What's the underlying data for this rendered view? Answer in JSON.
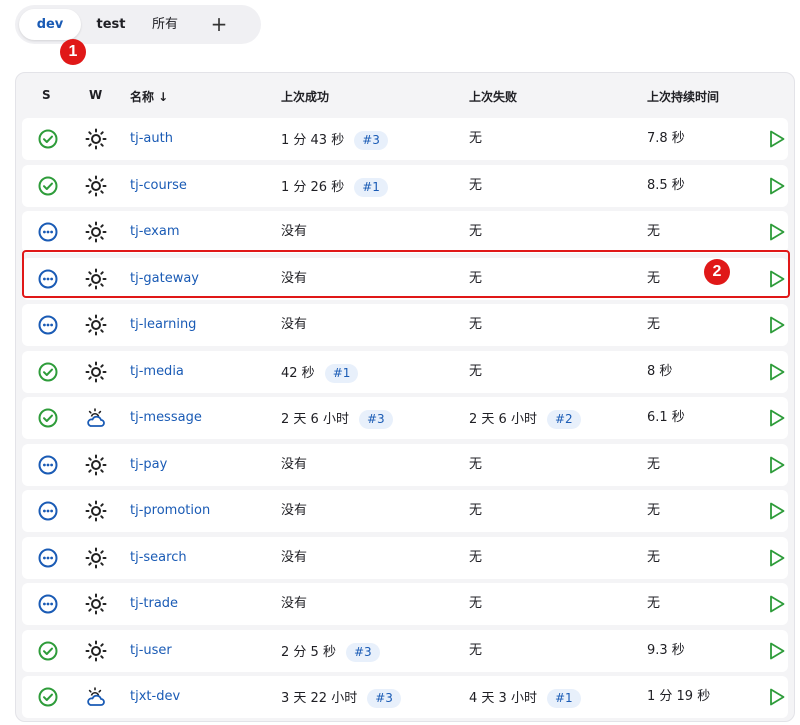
{
  "tabs": [
    {
      "label": "dev",
      "active": true
    },
    {
      "label": "test",
      "active": false
    },
    {
      "label": "所有",
      "active": false
    }
  ],
  "add_tab_label": "+",
  "annotations": [
    "1",
    "2"
  ],
  "columns": {
    "s": "S",
    "w": "W",
    "name": "名称 ↓",
    "last_success": "上次成功",
    "last_failure": "上次失败",
    "last_duration": "上次持续时间"
  },
  "colors": {
    "success": "#2e9c3a",
    "notbuilt": "#1a5bb5",
    "link": "#1a5bb5",
    "highlight": "#e01818",
    "run": "#2e9c3a"
  },
  "jobs": [
    {
      "status": "success-icon",
      "weather": "sunny-icon",
      "name": "tj-auth",
      "last_success": "1 分 43 秒",
      "success_build": "#3",
      "last_failure": "无",
      "failure_build": "",
      "last_duration": "7.8 秒"
    },
    {
      "status": "success-icon",
      "weather": "sunny-icon",
      "name": "tj-course",
      "last_success": "1 分 26 秒",
      "success_build": "#1",
      "last_failure": "无",
      "failure_build": "",
      "last_duration": "8.5 秒"
    },
    {
      "status": "notbuilt-icon",
      "weather": "sunny-icon",
      "name": "tj-exam",
      "last_success": "没有",
      "success_build": "",
      "last_failure": "无",
      "failure_build": "",
      "last_duration": "无"
    },
    {
      "status": "notbuilt-icon",
      "weather": "sunny-icon",
      "name": "tj-gateway",
      "last_success": "没有",
      "success_build": "",
      "last_failure": "无",
      "failure_build": "",
      "last_duration": "无"
    },
    {
      "status": "notbuilt-icon",
      "weather": "sunny-icon",
      "name": "tj-learning",
      "last_success": "没有",
      "success_build": "",
      "last_failure": "无",
      "failure_build": "",
      "last_duration": "无"
    },
    {
      "status": "success-icon",
      "weather": "sunny-icon",
      "name": "tj-media",
      "last_success": "42 秒",
      "success_build": "#1",
      "last_failure": "无",
      "failure_build": "",
      "last_duration": "8 秒"
    },
    {
      "status": "success-icon",
      "weather": "cloudy-icon",
      "name": "tj-message",
      "last_success": "2 天 6 小时",
      "success_build": "#3",
      "last_failure": "2 天 6 小时",
      "failure_build": "#2",
      "last_duration": "6.1 秒"
    },
    {
      "status": "notbuilt-icon",
      "weather": "sunny-icon",
      "name": "tj-pay",
      "last_success": "没有",
      "success_build": "",
      "last_failure": "无",
      "failure_build": "",
      "last_duration": "无"
    },
    {
      "status": "notbuilt-icon",
      "weather": "sunny-icon",
      "name": "tj-promotion",
      "last_success": "没有",
      "success_build": "",
      "last_failure": "无",
      "failure_build": "",
      "last_duration": "无"
    },
    {
      "status": "notbuilt-icon",
      "weather": "sunny-icon",
      "name": "tj-search",
      "last_success": "没有",
      "success_build": "",
      "last_failure": "无",
      "failure_build": "",
      "last_duration": "无"
    },
    {
      "status": "notbuilt-icon",
      "weather": "sunny-icon",
      "name": "tj-trade",
      "last_success": "没有",
      "success_build": "",
      "last_failure": "无",
      "failure_build": "",
      "last_duration": "无"
    },
    {
      "status": "success-icon",
      "weather": "sunny-icon",
      "name": "tj-user",
      "last_success": "2 分 5 秒",
      "success_build": "#3",
      "last_failure": "无",
      "failure_build": "",
      "last_duration": "9.3 秒"
    },
    {
      "status": "success-icon",
      "weather": "cloudy-icon",
      "name": "tjxt-dev",
      "last_success": "3 天 22 小时",
      "success_build": "#3",
      "last_failure": "4 天 3 小时",
      "failure_build": "#1",
      "last_duration": "1 分 19 秒"
    }
  ]
}
